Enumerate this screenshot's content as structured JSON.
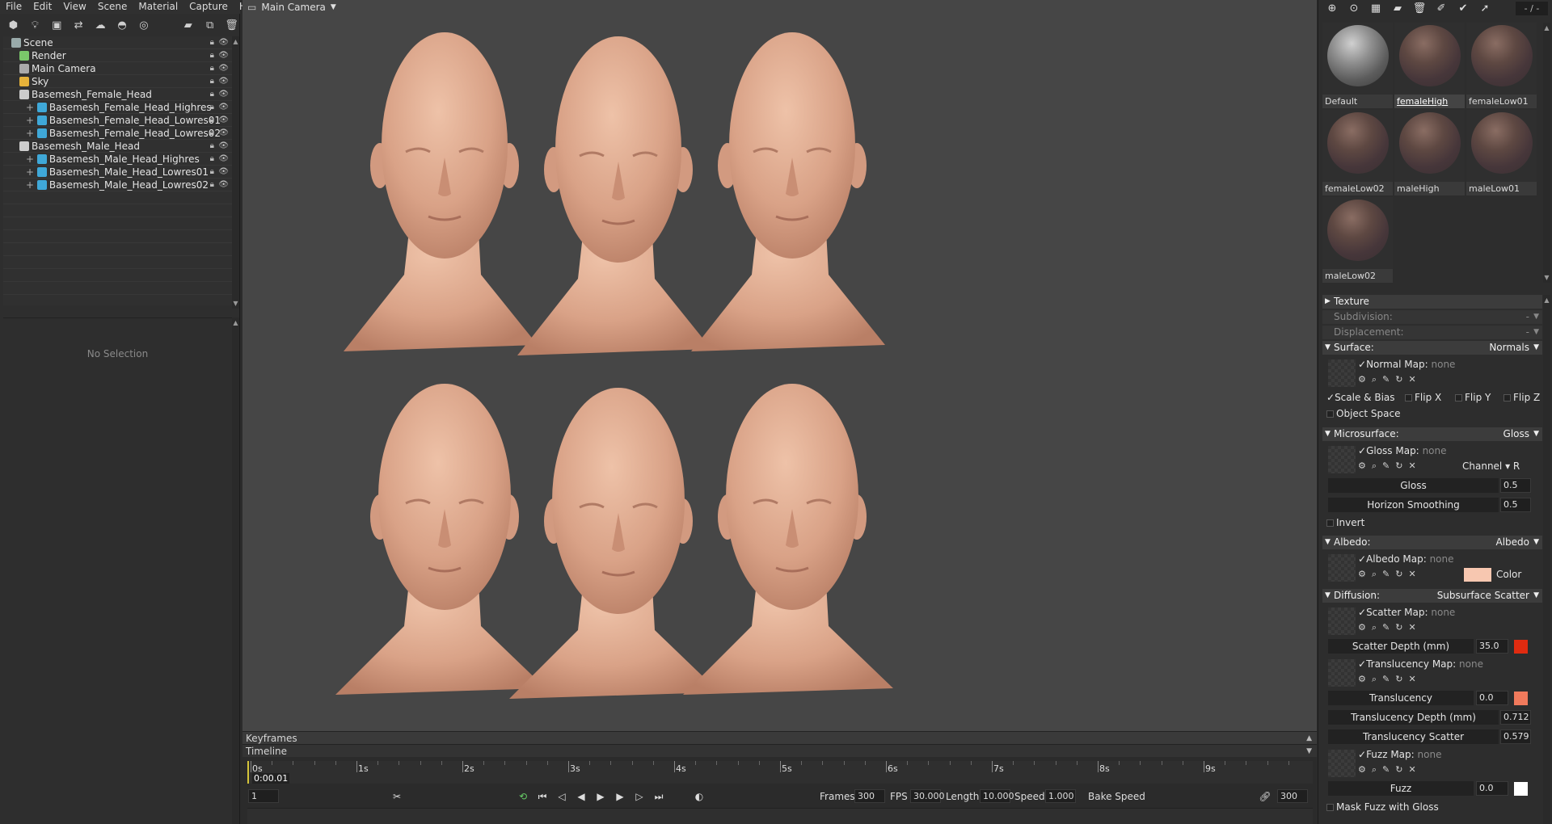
{
  "menu": [
    "File",
    "Edit",
    "View",
    "Scene",
    "Material",
    "Capture",
    "Help"
  ],
  "left_toolbar": [
    "mesh-icon",
    "light-icon",
    "camera-icon",
    "animation-icon",
    "sky-icon",
    "shadow-icon",
    "globe-icon",
    "folder-icon",
    "duplicate-icon",
    "delete-icon"
  ],
  "tree": [
    {
      "label": "Scene",
      "depth": 0,
      "icon": "scene-icon",
      "color": "#9aa"
    },
    {
      "label": "Render",
      "depth": 1,
      "icon": "render-icon",
      "color": "#7ac86a"
    },
    {
      "label": "Main Camera",
      "depth": 1,
      "icon": "camera-icon",
      "color": "#aaa"
    },
    {
      "label": "Sky",
      "depth": 1,
      "icon": "sky-icon",
      "color": "#e6b23a"
    },
    {
      "label": "Basemesh_Female_Head",
      "depth": 1,
      "icon": "group-icon",
      "color": "#ccc"
    },
    {
      "label": "Basemesh_Female_Head_Highres",
      "depth": 2,
      "icon": "mesh-icon",
      "color": "#3fa8d8"
    },
    {
      "label": "Basemesh_Female_Head_Lowres01",
      "depth": 2,
      "icon": "mesh-icon",
      "color": "#3fa8d8"
    },
    {
      "label": "Basemesh_Female_Head_Lowres02",
      "depth": 2,
      "icon": "mesh-icon",
      "color": "#3fa8d8"
    },
    {
      "label": "Basemesh_Male_Head",
      "depth": 1,
      "icon": "group-icon",
      "color": "#ccc"
    },
    {
      "label": "Basemesh_Male_Head_Highres",
      "depth": 2,
      "icon": "mesh-icon",
      "color": "#3fa8d8"
    },
    {
      "label": "Basemesh_Male_Head_Lowres01",
      "depth": 2,
      "icon": "mesh-icon",
      "color": "#3fa8d8"
    },
    {
      "label": "Basemesh_Male_Head_Lowres02",
      "depth": 2,
      "icon": "mesh-icon",
      "color": "#3fa8d8"
    }
  ],
  "no_selection": "No Selection",
  "viewport": {
    "camera": "Main Camera"
  },
  "timeline": {
    "keyframes_label": "Keyframes",
    "timeline_label": "Timeline",
    "ticks": [
      "0s",
      "1s",
      "2s",
      "3s",
      "4s",
      "5s",
      "6s",
      "7s",
      "8s",
      "9s"
    ],
    "current_time": "0:00.01",
    "frame_field": "1",
    "frames_label": "Frames",
    "frames": "300",
    "fps_label": "FPS",
    "fps": "30.000",
    "length_label": "Length",
    "length": "10.000",
    "speed_label": "Speed",
    "speed": "1.000",
    "bake_speed": "Bake Speed",
    "end_frame": "300"
  },
  "materials": {
    "count": "- / -",
    "toolbar": [
      "add-material-icon",
      "duplicate-material-icon",
      "checker-icon",
      "folder-icon",
      "delete-icon",
      "paint-icon",
      "select-icon",
      "link-icon"
    ],
    "items": [
      {
        "name": "Default",
        "kind": "default"
      },
      {
        "name": "femaleHigh",
        "kind": "skin",
        "selected": true
      },
      {
        "name": "femaleLow01",
        "kind": "skin"
      },
      {
        "name": "femaleLow02",
        "kind": "skin"
      },
      {
        "name": "maleHigh",
        "kind": "skin"
      },
      {
        "name": "maleLow01",
        "kind": "skin"
      },
      {
        "name": "maleLow02",
        "kind": "skin"
      }
    ]
  },
  "props": {
    "texture": "Texture",
    "subdivision": "Subdivision:",
    "subdivision_val": "-",
    "displacement": "Displacement:",
    "displacement_val": "-",
    "surface": "Surface:",
    "surface_val": "Normals",
    "normal_map": "Normal Map:",
    "none": "none",
    "scale_bias": "Scale & Bias",
    "flip_x": "Flip X",
    "flip_y": "Flip Y",
    "flip_z": "Flip Z",
    "object_space": "Object Space",
    "microsurface": "Microsurface:",
    "microsurface_val": "Gloss",
    "gloss_map": "Gloss Map:",
    "channel": "Channel",
    "channel_val": "R",
    "gloss": "Gloss",
    "gloss_val": "0.5",
    "horizon": "Horizon Smoothing",
    "horizon_val": "0.5",
    "invert": "Invert",
    "albedo": "Albedo:",
    "albedo_val": "Albedo",
    "albedo_map": "Albedo Map:",
    "color_label": "Color",
    "albedo_color": "#f7c7b0",
    "diffusion": "Diffusion:",
    "diffusion_val": "Subsurface Scatter",
    "scatter_map": "Scatter Map:",
    "scatter_depth": "Scatter Depth (mm)",
    "scatter_depth_val": "35.0",
    "scatter_color": "#e02b10",
    "translucency_map": "Translucency Map:",
    "translucency": "Translucency",
    "translucency_val": "0.0",
    "translucency_color": "#f07a5c",
    "translucency_depth": "Translucency Depth (mm)",
    "translucency_depth_val": "0.712",
    "translucency_scatter": "Translucency Scatter",
    "translucency_scatter_val": "0.579",
    "fuzz_map": "Fuzz Map:",
    "fuzz": "Fuzz",
    "fuzz_val": "0.0",
    "fuzz_color": "#ffffff",
    "mask_fuzz": "Mask Fuzz with Gloss"
  }
}
